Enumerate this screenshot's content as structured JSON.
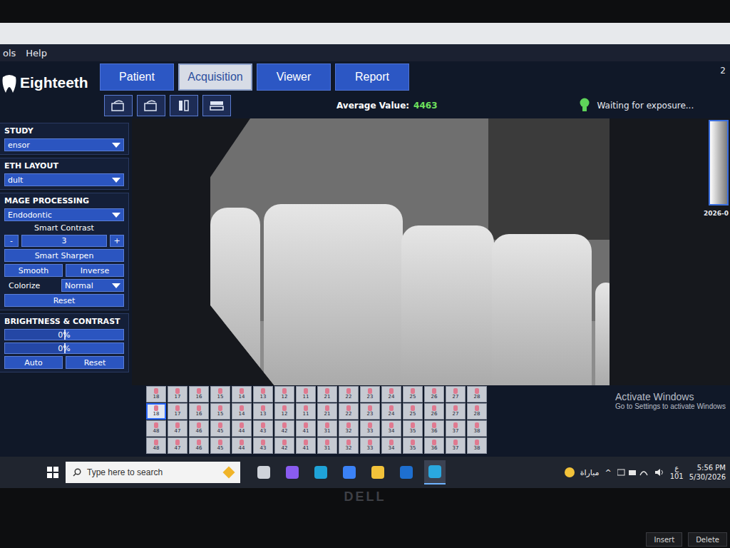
{
  "window": {
    "menu": [
      "ols",
      "Help"
    ],
    "corner_text": "2"
  },
  "logo": {
    "name": "Eighteeth"
  },
  "tabs": [
    {
      "label": "Patient",
      "selected": false
    },
    {
      "label": "Acquisition",
      "selected": true
    },
    {
      "label": "Viewer",
      "selected": false
    },
    {
      "label": "Report",
      "selected": false
    }
  ],
  "toolbar": {
    "average_label": "Average Value:",
    "average_value": "4463",
    "status": "Waiting for exposure..."
  },
  "panel": {
    "study_label": "STUDY",
    "study_value": "ensor",
    "layout_label": "ETH LAYOUT",
    "layout_value": "dult",
    "processing_label": "MAGE PROCESSING",
    "processing_value": "Endodontic",
    "smart_contrast_label": "Smart Contrast",
    "minus": "-",
    "contrast_value": "3",
    "plus": "+",
    "smart_sharpen": "Smart Sharpen",
    "smooth": "Smooth",
    "inverse": "Inverse",
    "colorize_label": "Colorize",
    "colorize_value": "Normal",
    "reset": "Reset",
    "bc_label": "BRIGHTNESS & CONTRAST",
    "sliders": [
      {
        "name": "brightness",
        "reading": "0%",
        "level": 0.5
      },
      {
        "name": "contrast",
        "reading": "0%",
        "level": 0.5
      }
    ],
    "auto": "Auto",
    "bc_reset": "Reset"
  },
  "thumbnail": {
    "date": "2026-0"
  },
  "tooth_chart": {
    "rows": [
      [
        {
          "label": "18",
          "selected": false
        },
        {
          "label": "17",
          "selected": false
        },
        {
          "label": "16",
          "selected": false
        },
        {
          "label": "15",
          "selected": false
        },
        {
          "label": "14",
          "selected": false
        },
        {
          "label": "13",
          "selected": false
        },
        {
          "label": "12",
          "selected": false
        },
        {
          "label": "11",
          "selected": false
        },
        {
          "label": "21",
          "selected": false
        },
        {
          "label": "22",
          "selected": false
        },
        {
          "label": "23",
          "selected": false
        },
        {
          "label": "24",
          "selected": false
        },
        {
          "label": "25",
          "selected": false
        },
        {
          "label": "26",
          "selected": false
        },
        {
          "label": "27",
          "selected": false
        },
        {
          "label": "28",
          "selected": false
        }
      ],
      [
        {
          "label": "18",
          "selected": true
        },
        {
          "label": "17",
          "selected": false
        },
        {
          "label": "16",
          "selected": false
        },
        {
          "label": "15",
          "selected": false
        },
        {
          "label": "14",
          "selected": false
        },
        {
          "label": "13",
          "selected": false
        },
        {
          "label": "12",
          "selected": false
        },
        {
          "label": "11",
          "selected": false
        },
        {
          "label": "21",
          "selected": false
        },
        {
          "label": "22",
          "selected": false
        },
        {
          "label": "23",
          "selected": false
        },
        {
          "label": "24",
          "selected": false
        },
        {
          "label": "25",
          "selected": false
        },
        {
          "label": "26",
          "selected": false
        },
        {
          "label": "27",
          "selected": false
        },
        {
          "label": "28",
          "selected": false
        }
      ],
      [
        {
          "label": "48",
          "selected": false
        },
        {
          "label": "47",
          "selected": false
        },
        {
          "label": "46",
          "selected": false
        },
        {
          "label": "45",
          "selected": false
        },
        {
          "label": "44",
          "selected": false
        },
        {
          "label": "43",
          "selected": false
        },
        {
          "label": "42",
          "selected": false
        },
        {
          "label": "41",
          "selected": false
        },
        {
          "label": "31",
          "selected": false
        },
        {
          "label": "32",
          "selected": false
        },
        {
          "label": "33",
          "selected": false
        },
        {
          "label": "34",
          "selected": false
        },
        {
          "label": "35",
          "selected": false
        },
        {
          "label": "36",
          "selected": false
        },
        {
          "label": "37",
          "selected": false
        },
        {
          "label": "38",
          "selected": false
        }
      ],
      [
        {
          "label": "48",
          "selected": false
        },
        {
          "label": "47",
          "selected": false
        },
        {
          "label": "46",
          "selected": false
        },
        {
          "label": "45",
          "selected": false
        },
        {
          "label": "44",
          "selected": false
        },
        {
          "label": "43",
          "selected": false
        },
        {
          "label": "42",
          "selected": false
        },
        {
          "label": "41",
          "selected": false
        },
        {
          "label": "31",
          "selected": false
        },
        {
          "label": "32",
          "selected": false
        },
        {
          "label": "33",
          "selected": false
        },
        {
          "label": "34",
          "selected": false
        },
        {
          "label": "35",
          "selected": false
        },
        {
          "label": "36",
          "selected": false
        },
        {
          "label": "37",
          "selected": false
        },
        {
          "label": "38",
          "selected": false
        }
      ]
    ]
  },
  "watermark": {
    "title": "Activate Windows",
    "subtitle": "Go to Settings to activate Windows"
  },
  "taskbar": {
    "search_placeholder": "Type here to search",
    "apps": [
      {
        "name": "task-view",
        "selected": false,
        "color": "#cfd3da"
      },
      {
        "name": "copilot",
        "selected": false,
        "color": "#8a5cf0"
      },
      {
        "name": "edge",
        "selected": false,
        "color": "#1fa3d8"
      },
      {
        "name": "store",
        "selected": false,
        "color": "#3b82f6"
      },
      {
        "name": "explorer",
        "selected": false,
        "color": "#f2c23a"
      },
      {
        "name": "outlook",
        "selected": false,
        "color": "#1e6fd0"
      },
      {
        "name": "eighteeth",
        "selected": true,
        "color": "#2aa8e0"
      }
    ],
    "weather": "مباراة",
    "chevron": "^",
    "language": "ع",
    "language_sub": "101",
    "time": "5:56 PM",
    "date": "5/30/2026"
  },
  "laptop": {
    "brand": "DELL",
    "keys": [
      "Insert",
      "Delete"
    ]
  }
}
